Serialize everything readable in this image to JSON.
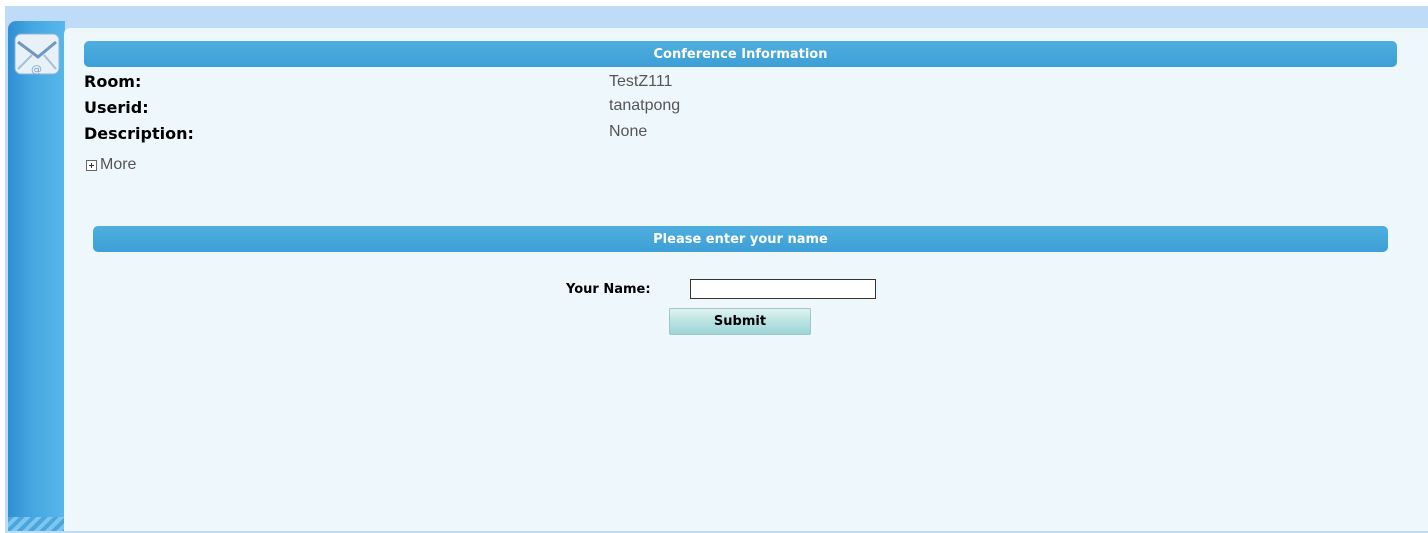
{
  "conference": {
    "header": "Conference Information",
    "rows": [
      {
        "label": "Room:",
        "value": "TestZ111"
      },
      {
        "label": "Userid:",
        "value": "tanatpong"
      },
      {
        "label": "Description:",
        "value": "None"
      }
    ],
    "more_label": "More"
  },
  "name_form": {
    "header": "Please enter your name",
    "name_label": "Your Name:",
    "name_value": "",
    "submit_label": "Submit"
  },
  "icons": {
    "app": "mail-icon",
    "expand": "plus-box-icon"
  },
  "colors": {
    "accent": "#3d9fd6",
    "background": "#bedcf7",
    "panel": "#eef7fb",
    "button": "#b9e3e2"
  }
}
